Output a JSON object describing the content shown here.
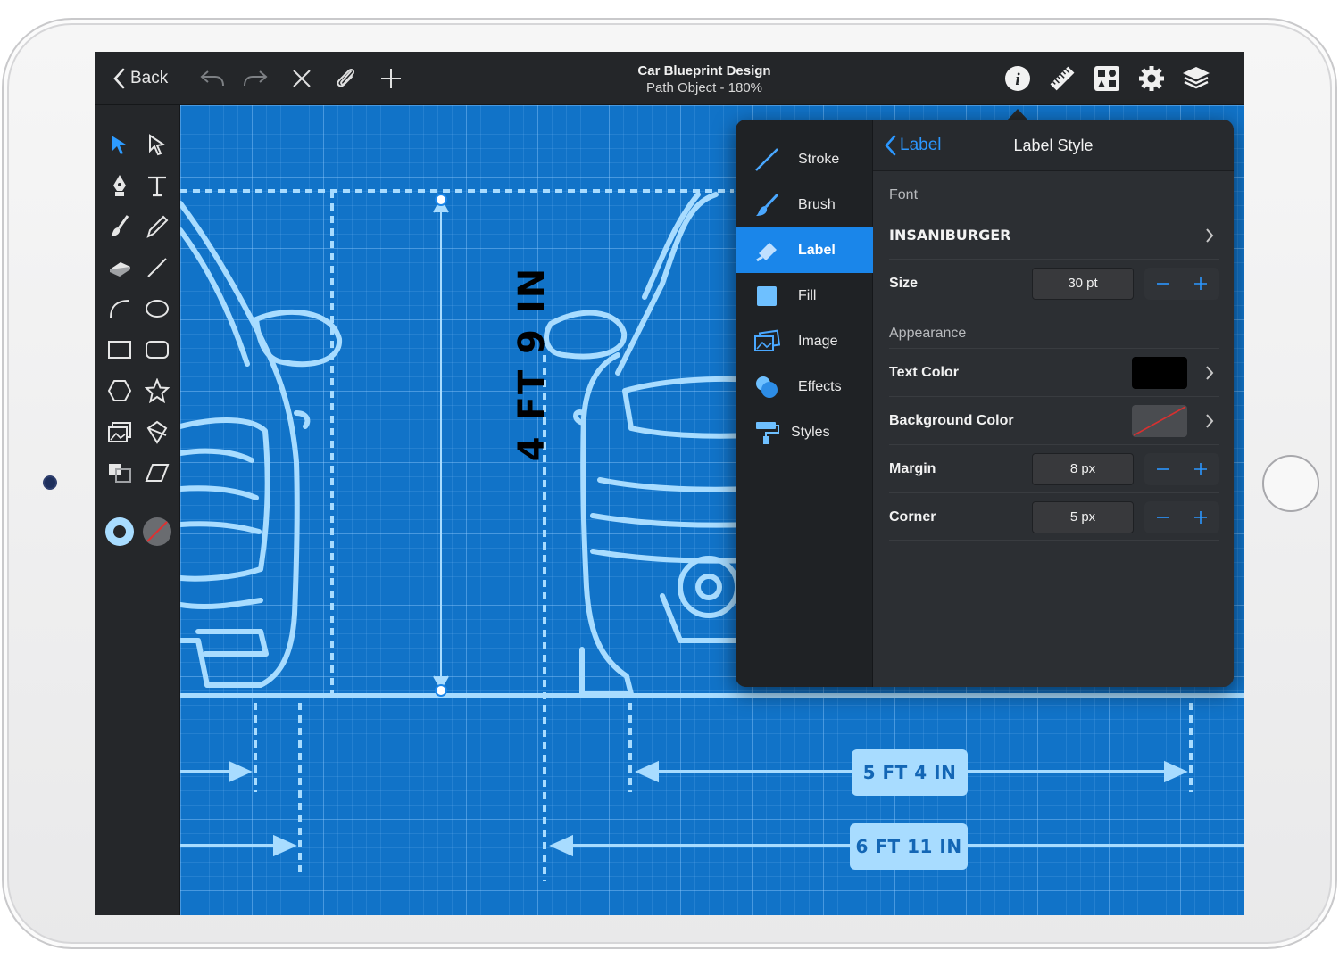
{
  "toolbar": {
    "back_label": "Back",
    "doc_title": "Car Blueprint Design",
    "doc_subtitle": "Path Object - 180%"
  },
  "canvas": {
    "vertical_dimension": "4 FT 9 IN",
    "dimension_1": "5 FT 4 IN",
    "dimension_2": "6 FT 11 IN"
  },
  "inspector": {
    "categories": [
      {
        "label": "Stroke",
        "icon": "stroke-icon"
      },
      {
        "label": "Brush",
        "icon": "brush-icon"
      },
      {
        "label": "Label",
        "icon": "label-icon",
        "active": true
      },
      {
        "label": "Fill",
        "icon": "fill-icon"
      },
      {
        "label": "Image",
        "icon": "image-icon"
      },
      {
        "label": "Effects",
        "icon": "effects-icon"
      },
      {
        "label": "Styles",
        "icon": "styles-icon"
      }
    ],
    "back_label": "Label",
    "title": "Label Style",
    "font_section": "Font",
    "font_name": "INSANIBURGER",
    "size_label": "Size",
    "size_value": "30 pt",
    "appearance_section": "Appearance",
    "text_color_label": "Text Color",
    "text_color": "#000000",
    "background_color_label": "Background Color",
    "margin_label": "Margin",
    "margin_value": "8 px",
    "corner_label": "Corner",
    "corner_value": "5 px"
  },
  "colors": {
    "accent": "#1a86ea",
    "blueprint": "#1173c8",
    "line": "#a8dcff"
  }
}
